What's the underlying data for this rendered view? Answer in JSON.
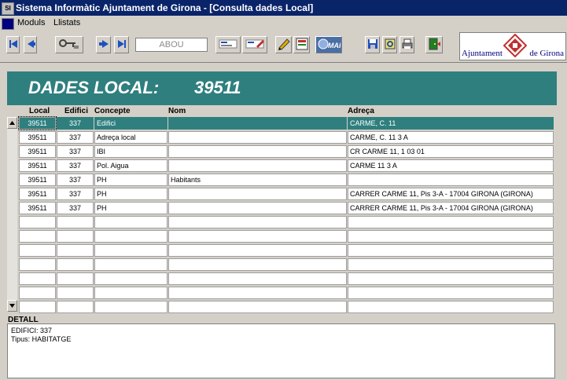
{
  "window": {
    "title": "Sistema Informàtic Ajuntament de Girona - [Consulta dades Local]"
  },
  "menu": [
    "Moduls",
    "Llistats"
  ],
  "toolbar": {
    "search_value": "ABOU",
    "map_label": "MAP"
  },
  "logo": {
    "line1": "Ajuntament",
    "line2": "de Girona"
  },
  "header": {
    "label": "DADES LOCAL:",
    "value": "39511"
  },
  "columns": [
    "Local",
    "Edifici",
    "Concepte",
    "Nom",
    "Adreça"
  ],
  "rows": [
    {
      "local": "39511",
      "edifici": "337",
      "concepte": "Edifici",
      "nom": "",
      "adreca": "CARME, C. 11"
    },
    {
      "local": "39511",
      "edifici": "337",
      "concepte": "Adreça local",
      "nom": "",
      "adreca": "CARME, C. 11  3 A"
    },
    {
      "local": "39511",
      "edifici": "337",
      "concepte": "IBI",
      "nom": "",
      "adreca": "CR CARME 11, 1 03 01"
    },
    {
      "local": "39511",
      "edifici": "337",
      "concepte": "Pol. Aigua",
      "nom": "",
      "adreca": "CARME 11 3 A"
    },
    {
      "local": "39511",
      "edifici": "337",
      "concepte": "PH",
      "nom": "Habitants",
      "adreca": ""
    },
    {
      "local": "39511",
      "edifici": "337",
      "concepte": "PH",
      "nom": "",
      "adreca": "CARRER CARME 11, Pis 3-A - 17004 GIRONA (GIRONA)"
    },
    {
      "local": "39511",
      "edifici": "337",
      "concepte": "PH",
      "nom": "",
      "adreca": "CARRER CARME 11, Pis 3-A - 17004 GIRONA (GIRONA)"
    }
  ],
  "detail": {
    "label": "DETALL",
    "text": "EDIFICI: 337\nTipus: HABITATGE"
  },
  "colors": {
    "teal": "#2f7f7f",
    "titlebar": "#0a246a",
    "chrome": "#d4d0c8"
  }
}
